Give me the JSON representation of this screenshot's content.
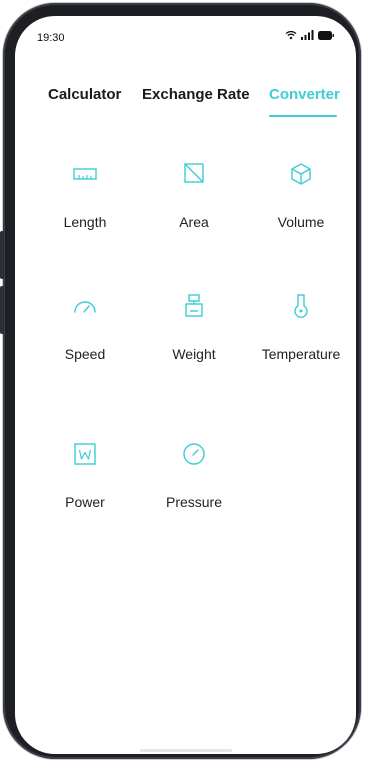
{
  "status_bar": {
    "time": "19:30"
  },
  "tabs": [
    {
      "label": "Calculator",
      "active": false
    },
    {
      "label": "Exchange Rate",
      "active": false
    },
    {
      "label": "Converter",
      "active": true
    }
  ],
  "converters": [
    {
      "label": "Length",
      "icon": "ruler-icon"
    },
    {
      "label": "Area",
      "icon": "area-square-icon"
    },
    {
      "label": "Volume",
      "icon": "cube-icon"
    },
    {
      "label": "Speed",
      "icon": "speedometer-icon"
    },
    {
      "label": "Weight",
      "icon": "scale-weight-icon"
    },
    {
      "label": "Temperature",
      "icon": "thermometer-icon"
    },
    {
      "label": "Power",
      "icon": "power-w-icon"
    },
    {
      "label": "Pressure",
      "icon": "pressure-gauge-icon"
    }
  ],
  "colors": {
    "accent": "#3dcdd3",
    "text": "#222222"
  }
}
